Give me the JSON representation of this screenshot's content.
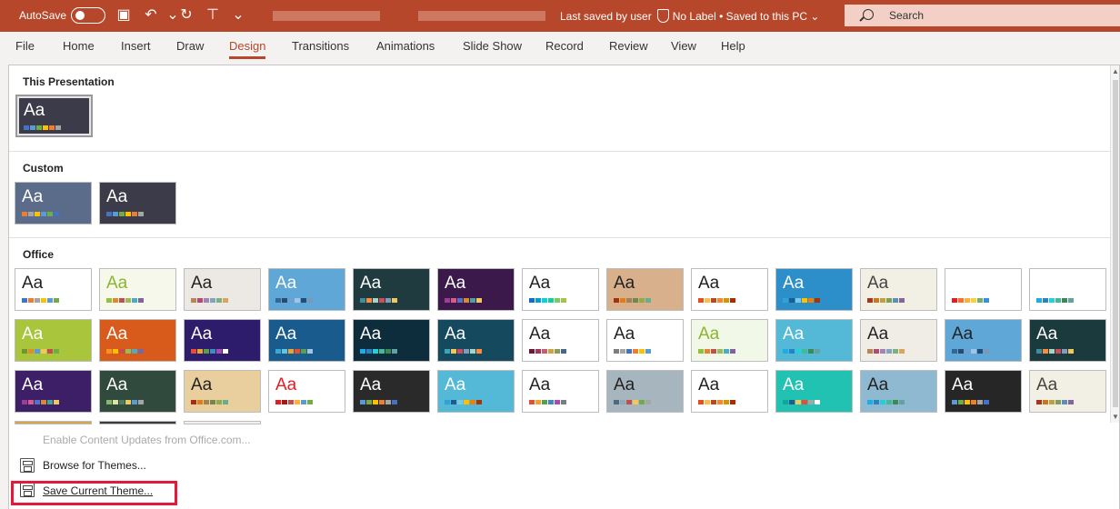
{
  "titlebar": {
    "autosave_label": "AutoSave",
    "status_saved": "Last saved by user",
    "label_text": "No Label",
    "saved_location": "Saved to this PC",
    "search_placeholder": "Search"
  },
  "ribbon": {
    "tabs": [
      "File",
      "Home",
      "Insert",
      "Draw",
      "Design",
      "Transitions",
      "Animations",
      "Slide Show",
      "Record",
      "Review",
      "View",
      "Help"
    ],
    "active_tab": "Design"
  },
  "gallery": {
    "this_presentation_label": "This Presentation",
    "custom_label": "Custom",
    "office_label": "Office",
    "thumbnail_text": "Aa"
  },
  "menu": {
    "enable_updates": "Enable Content Updates from Office.com...",
    "browse_themes": "Browse for Themes...",
    "save_theme": "Save Current Theme..."
  },
  "colors": {
    "accent": "#b7472a",
    "highlight": "#e11b38"
  }
}
